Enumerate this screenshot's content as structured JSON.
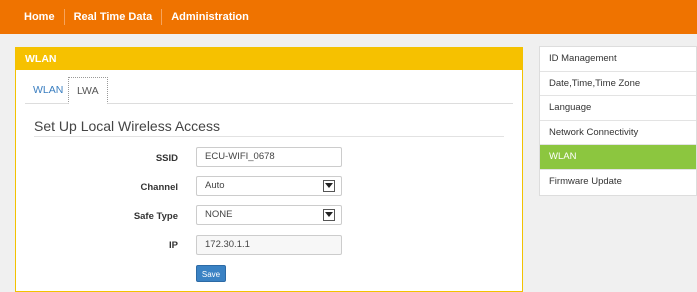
{
  "topnav": {
    "items": [
      "Home",
      "Real Time Data",
      "Administration"
    ]
  },
  "panel": {
    "title": "WLAN",
    "tabs": [
      "WLAN",
      "LWA"
    ],
    "section_title": "Set Up Local Wireless Access",
    "form": {
      "ssid_label": "SSID",
      "ssid_value": "ECU-WIFI_0678",
      "channel_label": "Channel",
      "channel_value": "Auto",
      "safe_type_label": "Safe Type",
      "safe_type_value": "NONE",
      "ip_label": "IP",
      "ip_value": "172.30.1.1"
    },
    "save_label": "Save"
  },
  "sidebar": {
    "items": [
      "ID Management",
      "Date,Time,Time Zone",
      "Language",
      "Network Connectivity",
      "WLAN",
      "Firmware Update"
    ],
    "active": "WLAN"
  },
  "colors": {
    "topnav": "#ef7300",
    "panel_header": "#f6c100",
    "active_sidebar": "#8cc63f",
    "save_button": "#3a82c4"
  }
}
